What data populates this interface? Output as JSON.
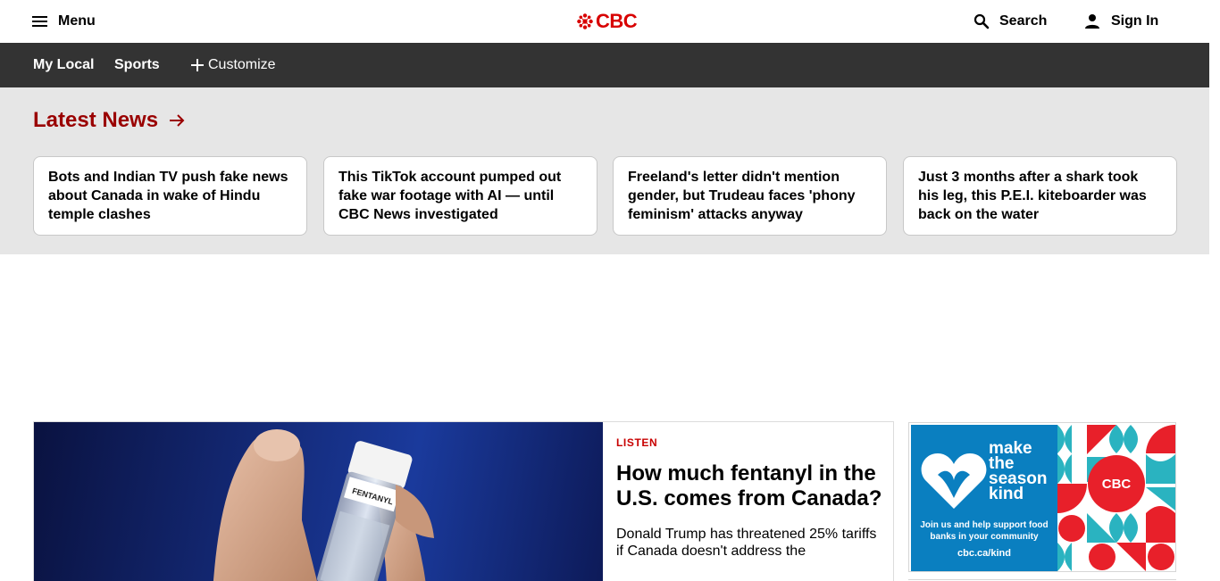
{
  "header": {
    "menu_label": "Menu",
    "logo_text": "CBC",
    "search_label": "Search",
    "signin_label": "Sign In",
    "brand_color": "#d80000"
  },
  "nav": {
    "items": [
      {
        "label": "My Local"
      },
      {
        "label": "Sports"
      }
    ],
    "customize_label": "Customize"
  },
  "latest_news": {
    "title": "Latest News",
    "accent_color": "#9a0000",
    "stories": [
      {
        "headline": "Bots and Indian TV push fake news about Canada in wake of Hindu temple clashes"
      },
      {
        "headline": "This TikTok account pumped out fake war footage with AI — until CBC News investigated"
      },
      {
        "headline": "Freeland's letter didn't mention gender, but Trudeau faces 'phony feminism' attacks anyway"
      },
      {
        "headline": "Just 3 months after a shark took his leg, this P.E.I. kiteboarder was back on the water"
      }
    ]
  },
  "feature": {
    "kicker": "LISTEN",
    "headline": "How much fentanyl in the U.S. comes from Canada?",
    "deck": "Donald Trump has threatened 25% tariffs if Canada doesn't address the",
    "image_label": "FENTANYL"
  },
  "ad": {
    "tagline_1": "make",
    "tagline_2": "the",
    "tagline_3": "season",
    "tagline_4": "kind",
    "subtext": "Join us and help support food banks in your community",
    "url": "cbc.ca/kind",
    "logo_text": "CBC"
  }
}
